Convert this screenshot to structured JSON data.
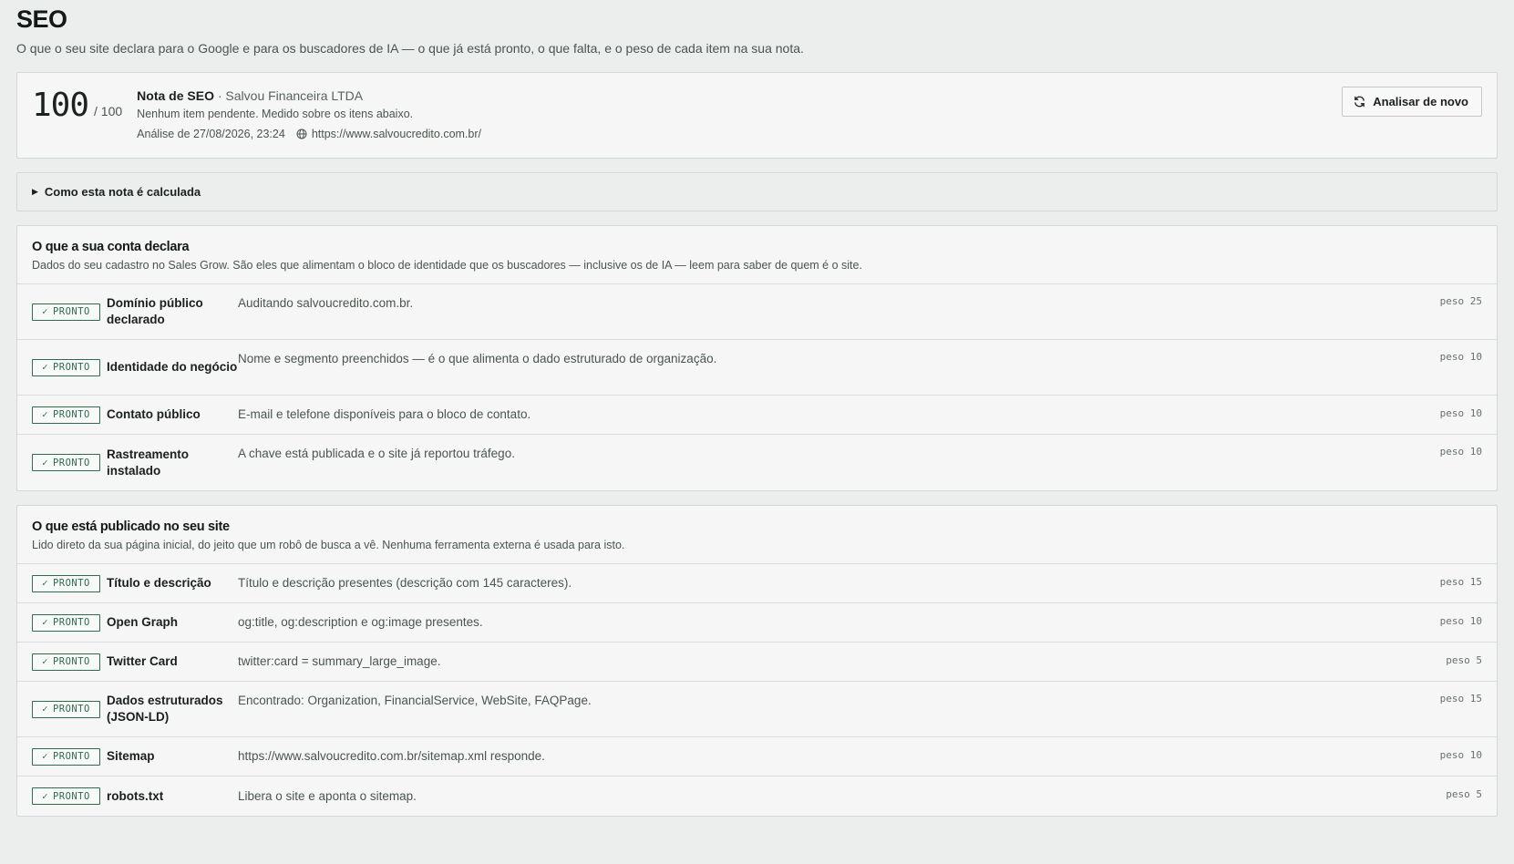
{
  "page": {
    "title": "SEO",
    "subtitle": "O que o seu site declara para o Google e para os buscadores de IA — o que já está pronto, o que falta, e o peso de cada item na sua nota."
  },
  "score": {
    "value": "100",
    "max": "/ 100",
    "label": "Nota de SEO",
    "separator": "·",
    "company": "Salvou Financeira LTDA",
    "description": "Nenhum item pendente. Medido sobre os itens abaixo.",
    "analysis_date": "Análise de 27/08/2026, 23:24",
    "url": "https://www.salvoucredito.com.br/",
    "reanalyze_label": "Analisar de novo"
  },
  "how": {
    "label": "Como esta nota é calculada"
  },
  "status_label": "PRONTO",
  "weight_prefix": "peso",
  "sections": [
    {
      "title": "O que a sua conta declara",
      "description": "Dados do seu cadastro no Sales Grow. São eles que alimentam o bloco de identidade que os buscadores — inclusive os de IA — leem para saber de quem é o site.",
      "items": [
        {
          "label": "Domínio público declarado",
          "text": "Auditando salvoucredito.com.br.",
          "weight": "peso 25"
        },
        {
          "label": "Identidade do negócio",
          "text": "Nome e segmento preenchidos — é o que alimenta o dado estruturado de organização.",
          "weight": "peso 10"
        },
        {
          "label": "Contato público",
          "text": "E-mail e telefone disponíveis para o bloco de contato.",
          "weight": "peso 10"
        },
        {
          "label": "Rastreamento instalado",
          "text": "A chave está publicada e o site já reportou tráfego.",
          "weight": "peso 10"
        }
      ]
    },
    {
      "title": "O que está publicado no seu site",
      "description": "Lido direto da sua página inicial, do jeito que um robô de busca a vê. Nenhuma ferramenta externa é usada para isto.",
      "items": [
        {
          "label": "Título e descrição",
          "text": "Título e descrição presentes (descrição com 145 caracteres).",
          "weight": "peso 15"
        },
        {
          "label": "Open Graph",
          "text": "og:title, og:description e og:image presentes.",
          "weight": "peso 10"
        },
        {
          "label": "Twitter Card",
          "text": "twitter:card = summary_large_image.",
          "weight": "peso 5"
        },
        {
          "label": "Dados estruturados (JSON-LD)",
          "text": "Encontrado: Organization, FinancialService, WebSite, FAQPage.",
          "weight": "peso 15"
        },
        {
          "label": "Sitemap",
          "text": "https://www.salvoucredito.com.br/sitemap.xml responde.",
          "weight": "peso 10"
        },
        {
          "label": "robots.txt",
          "text": "Libera o site e aponta o sitemap.",
          "weight": "peso 5"
        }
      ]
    }
  ]
}
